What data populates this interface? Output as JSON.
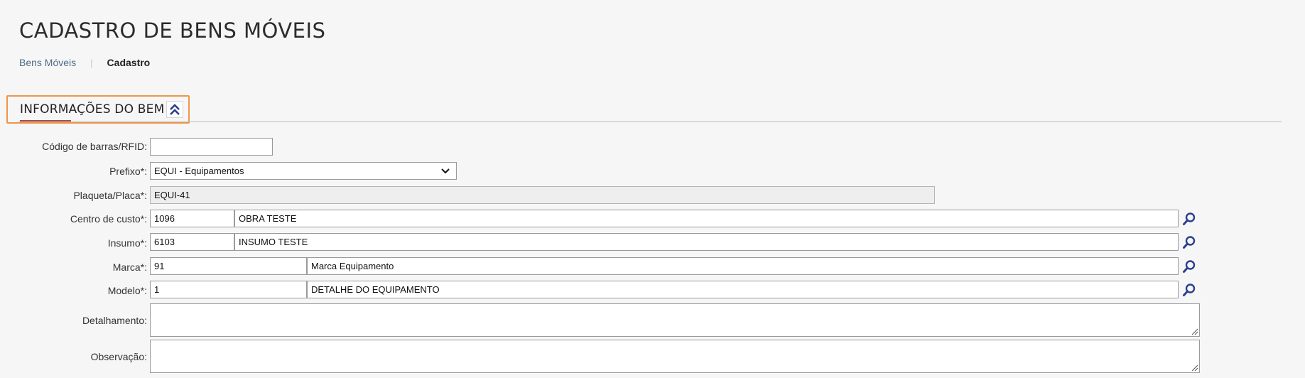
{
  "page": {
    "title": "CADASTRO DE BENS MÓVEIS",
    "breadcrumb": {
      "link": "Bens Móveis",
      "current": "Cadastro"
    }
  },
  "section": {
    "title": "INFORMAÇÕES DO BEM",
    "collapse_icon": "double-chevron-up-icon"
  },
  "form": {
    "barcode": {
      "label": "Código de barras/RFID:",
      "value": ""
    },
    "prefix": {
      "label": "Prefixo*:",
      "value": "EQUI - Equipamentos"
    },
    "plate": {
      "label": "Plaqueta/Placa*:",
      "value": "EQUI-41"
    },
    "cost_center": {
      "label": "Centro de custo*:",
      "code": "1096",
      "description": "OBRA TESTE"
    },
    "input": {
      "label": "Insumo*:",
      "code": "6103",
      "description": "INSUMO TESTE"
    },
    "brand": {
      "label": "Marca*:",
      "code": "91",
      "description": "Marca Equipamento"
    },
    "model": {
      "label": "Modelo*:",
      "code": "1",
      "description": "DETALHE DO EQUIPAMENTO"
    },
    "detail": {
      "label": "Detalhamento:",
      "value": ""
    },
    "observation": {
      "label": "Observação:",
      "value": ""
    }
  },
  "colors": {
    "accent_border": "#f0954a",
    "underline": "#b24a3a",
    "icon": "#2b3f8f"
  }
}
